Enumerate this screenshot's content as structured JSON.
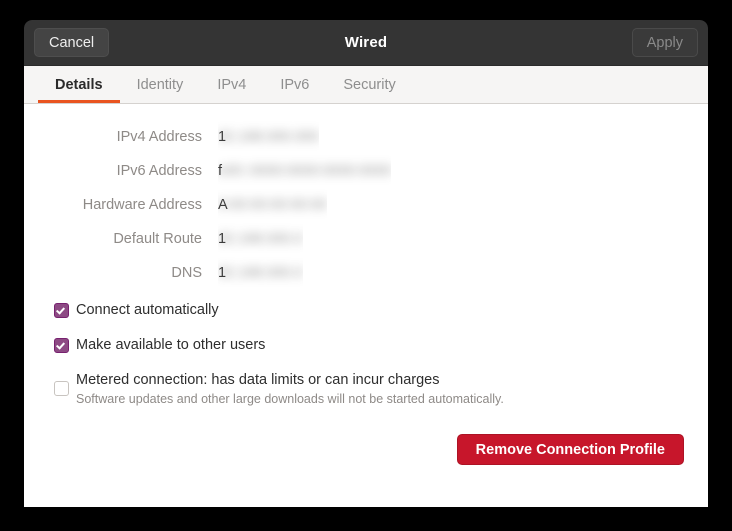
{
  "window": {
    "title": "Wired",
    "cancel_label": "Cancel",
    "apply_label": "Apply"
  },
  "tabs": [
    {
      "label": "Details",
      "active": true
    },
    {
      "label": "Identity",
      "active": false
    },
    {
      "label": "IPv4",
      "active": false
    },
    {
      "label": "IPv6",
      "active": false
    },
    {
      "label": "Security",
      "active": false
    }
  ],
  "details": [
    {
      "label": "IPv4 Address",
      "value_lead": "1",
      "value_redacted": "92.168.000.000"
    },
    {
      "label": "IPv6 Address",
      "value_lead": "f",
      "value_redacted": "e00::0000:0000:0000:0000"
    },
    {
      "label": "Hardware Address",
      "value_lead": "A",
      "value_redacted": "0:00:00:00:00:00"
    },
    {
      "label": "Default Route",
      "value_lead": "1",
      "value_redacted": "92.168.000.0"
    },
    {
      "label": "DNS",
      "value_lead": "1",
      "value_redacted": "92.168.000.0"
    }
  ],
  "options": {
    "connect_automatically": {
      "label": "Connect automatically",
      "checked": true
    },
    "make_available": {
      "label": "Make available to other users",
      "checked": true
    },
    "metered": {
      "label": "Metered connection: has data limits or can incur charges",
      "sublabel": "Software updates and other large downloads will not be started automatically.",
      "checked": false
    }
  },
  "actions": {
    "remove_label": "Remove Connection Profile"
  },
  "colors": {
    "accent_orange": "#e95420",
    "checkbox_purple": "#77216f",
    "destructive_red": "#c7162b",
    "titlebar_dark": "#343434"
  }
}
